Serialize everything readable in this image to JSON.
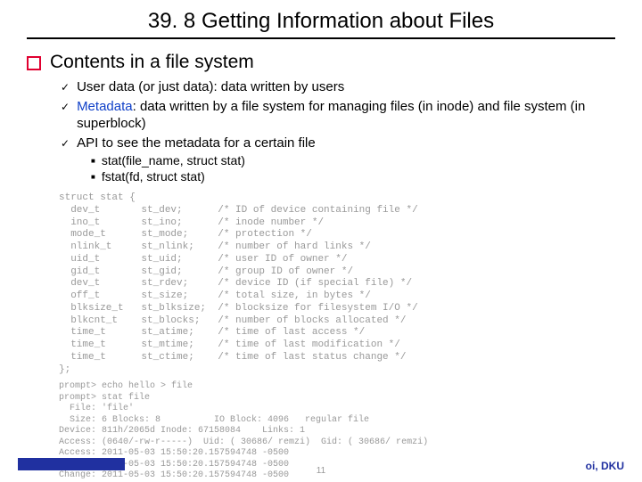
{
  "title": "39. 8 Getting Information about Files",
  "h1": "Contents in a file system",
  "b1": "User data (or just data): data written by users",
  "b2a": "Metadata",
  "b2b": ": data written by a file system for managing files (in inode) and file system (in superblock)",
  "b3": "API to see the metadata for a certain file",
  "api1": "stat(file_name, struct stat)",
  "api2": "fstat(fd, struct stat)",
  "struct_code": "struct stat {\n  dev_t       st_dev;      /* ID of device containing file */\n  ino_t       st_ino;      /* inode number */\n  mode_t      st_mode;     /* protection */\n  nlink_t     st_nlink;    /* number of hard links */\n  uid_t       st_uid;      /* user ID of owner */\n  gid_t       st_gid;      /* group ID of owner */\n  dev_t       st_rdev;     /* device ID (if special file) */\n  off_t       st_size;     /* total size, in bytes */\n  blksize_t   st_blksize;  /* blocksize for filesystem I/O */\n  blkcnt_t    st_blocks;   /* number of blocks allocated */\n  time_t      st_atime;    /* time of last access */\n  time_t      st_mtime;    /* time of last modification */\n  time_t      st_ctime;    /* time of last status change */\n};",
  "terminal": "prompt> echo hello > file\nprompt> stat file\n  File: 'file'\n  Size: 6 Blocks: 8          IO Block: 4096   regular file\nDevice: 811h/2065d Inode: 67158084    Links: 1\nAccess: (0640/-rw-r-----)  Uid: ( 30686/ remzi)  Gid: ( 30686/ remzi)\nAccess: 2011-05-03 15:50:20.157594748 -0500\nModify: 2011-05-03 15:50:20.157594748 -0500\nChange: 2011-05-03 15:50:20.157594748 -0500",
  "footer_right": "oi, DKU",
  "page_num": "11"
}
